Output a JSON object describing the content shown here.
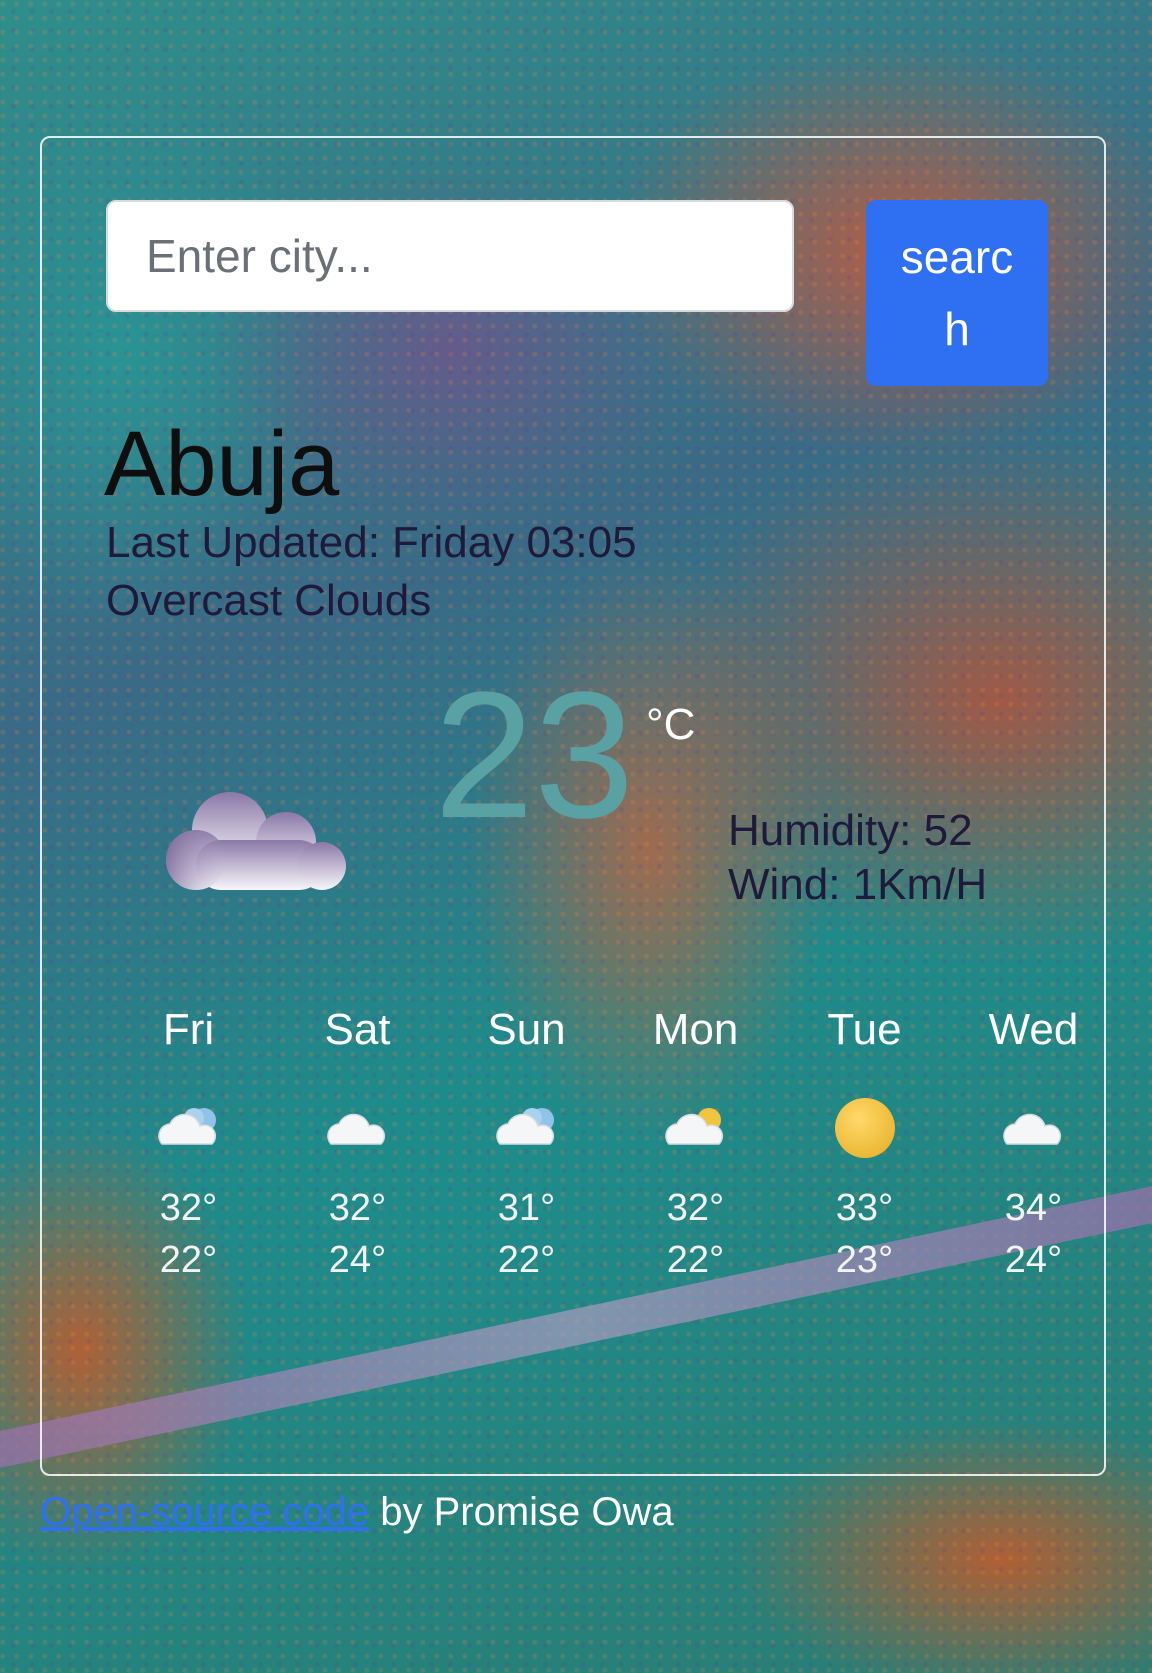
{
  "search": {
    "placeholder": "Enter city...",
    "button_label": "search"
  },
  "current": {
    "city": "Abuja",
    "last_updated_label": "Last Updated:",
    "last_updated_value": "Friday 03:05",
    "condition": "Overcast Clouds",
    "icon": "overcast-cloud-icon",
    "temperature": "23",
    "unit": "°C",
    "humidity": "Humidity: 52",
    "wind": "Wind: 1Km/H"
  },
  "forecast": [
    {
      "day": "Fri",
      "icon": "cloud-sun-blue-icon",
      "high": "32°",
      "low": "22°"
    },
    {
      "day": "Sat",
      "icon": "cloud-icon",
      "high": "32°",
      "low": "24°"
    },
    {
      "day": "Sun",
      "icon": "cloud-sun-blue-icon",
      "high": "31°",
      "low": "22°"
    },
    {
      "day": "Mon",
      "icon": "partly-cloudy-sun-icon",
      "high": "32°",
      "low": "22°"
    },
    {
      "day": "Tue",
      "icon": "sun-icon",
      "high": "33°",
      "low": "23°"
    },
    {
      "day": "Wed",
      "icon": "cloud-icon",
      "high": "34°",
      "low": "24°"
    }
  ],
  "footer": {
    "link_text": "Open-source code",
    "suffix": " by Promise Owa"
  },
  "colors": {
    "accent": "#2f6ff2",
    "temperature": "#5aa1a4",
    "text_dark": "#1f1a3c"
  }
}
